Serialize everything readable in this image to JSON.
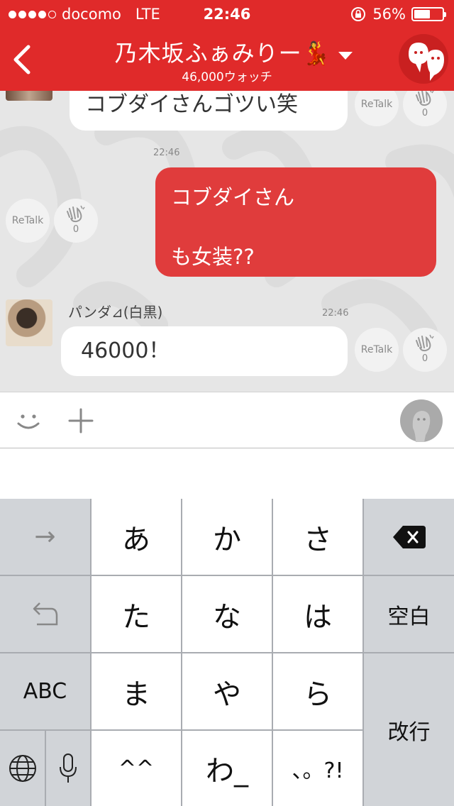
{
  "status_bar": {
    "carrier": "docomo",
    "network": "LTE",
    "time": "22:46",
    "battery": "56%",
    "signal_bars": 4
  },
  "header": {
    "title": "乃木坂ふぁみりー💃",
    "subtitle": "46,000ウォッチ",
    "color": "#e02a2a"
  },
  "messages": [
    {
      "type": "incoming",
      "text": "コブダイさんゴツい笑",
      "retalk": "ReTalk",
      "claps": "0"
    },
    {
      "type": "outgoing",
      "time": "22:46",
      "line1": "コブダイさん",
      "line2": "も女装??",
      "retalk": "ReTalk",
      "claps": "0"
    },
    {
      "type": "incoming",
      "user": "パンダ⊿(白黒)",
      "time": "22:46",
      "text": "46000！",
      "retalk": "ReTalk",
      "claps": "0"
    }
  ],
  "keyboard": {
    "rows": [
      [
        "→",
        "あ",
        "か",
        "さ",
        "⌫"
      ],
      [
        "↶",
        "た",
        "な",
        "は",
        "空白"
      ],
      [
        "ABC",
        "ま",
        "や",
        "ら",
        "改行"
      ],
      [
        "🌐",
        "🎤",
        "^^",
        "わ_",
        "、。?!"
      ]
    ],
    "next_label": "→",
    "undo_label": "↶",
    "abc_label": "ABC",
    "space_label": "空白",
    "return_label": "改行",
    "kana": {
      "a": "あ",
      "ka": "か",
      "sa": "さ",
      "ta": "た",
      "na": "な",
      "ha": "は",
      "ma": "ま",
      "ya": "や",
      "ra": "ら",
      "emoticon": "^^",
      "wa": "わ_",
      "punct": "、。?!"
    }
  }
}
